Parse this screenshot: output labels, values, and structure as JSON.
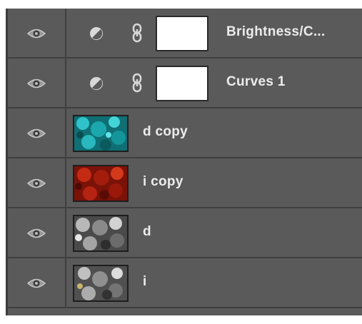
{
  "layers": [
    {
      "name": "Brightness/C...",
      "kind": "adjustment",
      "visible_icon": "eye-icon",
      "adjustment_icon": "half-circle-adjustment-icon",
      "link_icon": "chain-link-icon"
    },
    {
      "name": "Curves 1",
      "kind": "adjustment",
      "visible_icon": "eye-icon",
      "adjustment_icon": "half-circle-adjustment-icon",
      "link_icon": "chain-link-icon"
    },
    {
      "name": "d copy",
      "kind": "pixel",
      "visible_icon": "eye-icon",
      "thumb_color": "#1f9a9f"
    },
    {
      "name": "i copy",
      "kind": "pixel",
      "visible_icon": "eye-icon",
      "thumb_color": "#b0200f"
    },
    {
      "name": "d",
      "kind": "pixel",
      "visible_icon": "eye-icon",
      "thumb_color": "#8c8c8c"
    },
    {
      "name": "i",
      "kind": "pixel",
      "visible_icon": "eye-icon",
      "thumb_color": "#8c8c8c"
    }
  ],
  "colors": {
    "panel_bg": "#5a5a5a",
    "divider": "#3f3f3f",
    "text": "#ececec"
  }
}
